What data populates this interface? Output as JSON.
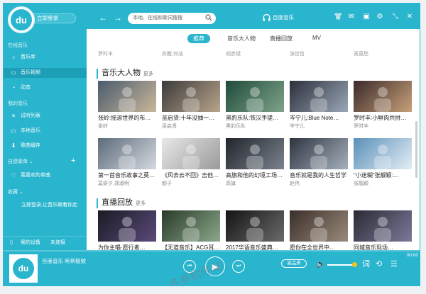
{
  "header": {
    "login_label": "立即登录",
    "search_placeholder": "本地、在线和歌词搜搜",
    "brand": "百度音乐"
  },
  "sidebar": {
    "online_label": "在线音乐",
    "online_items": [
      "音乐库",
      "音乐视频",
      "动态"
    ],
    "mymusic_label": "我的音乐",
    "mymusic_items": [
      "试听列表",
      "本地音乐",
      "歌曲缓存"
    ],
    "playlists_label": "自建歌单",
    "playlist_items": [
      "我喜欢的单曲"
    ],
    "favorites_label": "收藏",
    "favorites_hint": "立即登录,让音乐跟着你走",
    "device_label": "我的设备",
    "device_status": "未连接"
  },
  "tabs": [
    "推荐",
    "音乐大人物",
    "直播回放",
    "MV"
  ],
  "header_names": [
    "罗时丰",
    "苏醒,何洁",
    "胡彦斌",
    "张信哲",
    "吴莫愁"
  ],
  "sections": [
    {
      "title": "音乐大人物",
      "more": "更多"
    },
    {
      "title": "直播回放",
      "more": "更多"
    }
  ],
  "row1": [
    {
      "title": "张岭:摇滚世界的布…",
      "sub": "张岭"
    },
    {
      "title": "巫启贤:十年没抽一…",
      "sub": "巫启贤"
    },
    {
      "title": "黑豹乐队:铁汉手搓…",
      "sub": "黑豹乐队"
    },
    {
      "title": "岑宁儿:Blue Note…",
      "sub": "岑宁儿"
    },
    {
      "title": "罗时丰:小鲜肉共拼…",
      "sub": "罗时丰"
    }
  ],
  "row2": [
    {
      "title": "第一首音乐故事之莫…",
      "sub": "莫妍夕,郑淑明"
    },
    {
      "title": "《风去云不回》吉他…",
      "sub": "颜子"
    },
    {
      "title": "高旗和他的幻境工场…",
      "sub": "高旗"
    },
    {
      "title": "音乐就是我的人生哲学",
      "sub": "赵伟"
    },
    {
      "title": "\"小迷糊\"张靓颖:…",
      "sub": "张靓颖"
    }
  ],
  "row3": [
    {
      "title": "为你主唱·愿行者…"
    },
    {
      "title": "【无道音乐】ACG耳…"
    },
    {
      "title": "2017华语音乐盛典…"
    },
    {
      "title": "愿你在全世界中…"
    },
    {
      "title": "同城音乐现场…"
    }
  ],
  "player": {
    "title": "百度音乐",
    "subtitle": "听到极致",
    "quality": "高品质",
    "time": "00:00",
    "lyrics_label": "词"
  },
  "watermark": "多多软件站"
}
